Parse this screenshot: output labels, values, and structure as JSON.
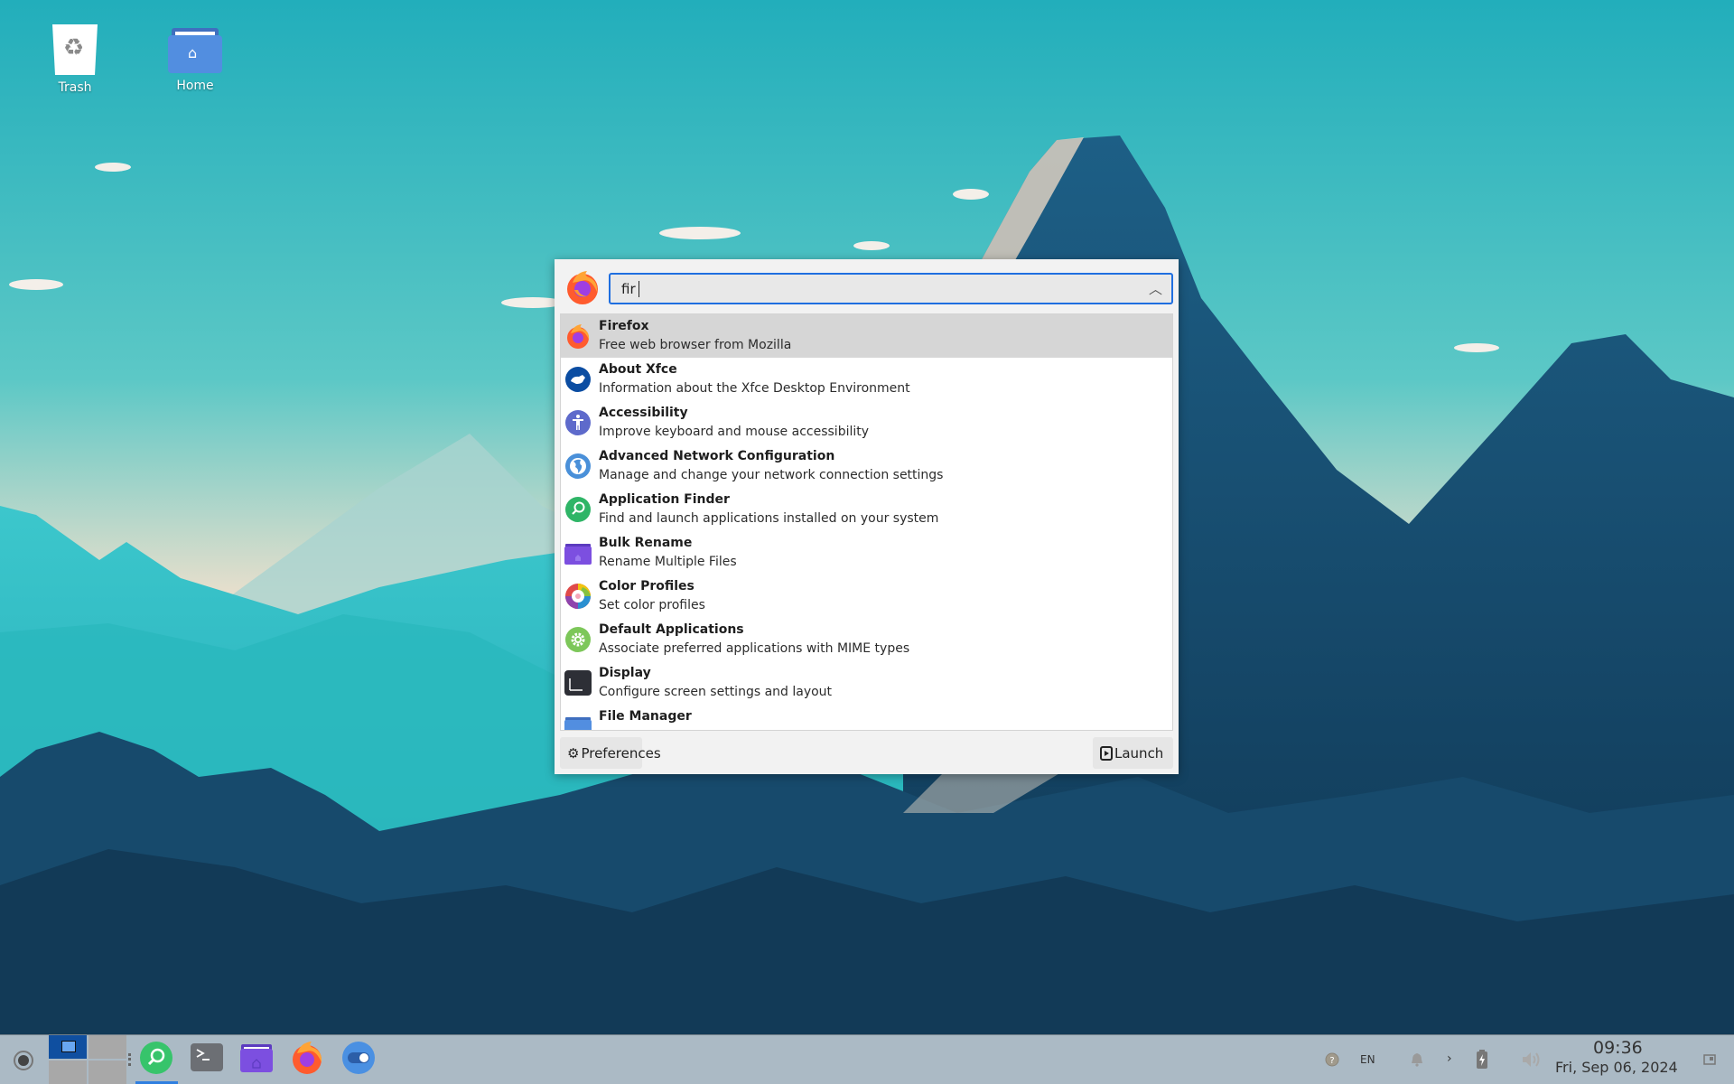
{
  "desktop": {
    "icons": [
      {
        "label": "Trash",
        "icon": "trash-icon"
      },
      {
        "label": "Home",
        "icon": "home-folder-icon"
      }
    ]
  },
  "app_finder": {
    "app_icon": "firefox-icon",
    "search": {
      "value": "fir",
      "placeholder": ""
    },
    "collapse_icon": "chevron-up-icon",
    "results": [
      {
        "name": "Firefox",
        "description": "Free web browser from Mozilla",
        "icon": "firefox-icon",
        "selected": true
      },
      {
        "name": "About Xfce",
        "description": "Information about the Xfce Desktop Environment",
        "icon": "xfce-mouse-icon"
      },
      {
        "name": "Accessibility",
        "description": "Improve keyboard and mouse accessibility",
        "icon": "accessibility-icon"
      },
      {
        "name": "Advanced Network Configuration",
        "description": "Manage and change your network connection settings",
        "icon": "network-globe-icon"
      },
      {
        "name": "Application Finder",
        "description": "Find and launch applications installed on your system",
        "icon": "search-icon"
      },
      {
        "name": "Bulk Rename",
        "description": "Rename Multiple Files",
        "icon": "folder-icon"
      },
      {
        "name": "Color Profiles",
        "description": "Set color profiles",
        "icon": "color-wheel-icon"
      },
      {
        "name": "Default Applications",
        "description": "Associate preferred applications with MIME types",
        "icon": "gear-icon"
      },
      {
        "name": "Display",
        "description": "Configure screen settings and layout",
        "icon": "display-icon"
      },
      {
        "name": "File Manager",
        "description": "",
        "icon": "folder-icon"
      }
    ],
    "buttons": {
      "preferences": {
        "label": "Preferences",
        "icon": "gear-icon"
      },
      "launch": {
        "label": "Launch",
        "icon": "play-icon"
      }
    }
  },
  "panel": {
    "menu_icon": "whisker-menu-icon",
    "workspaces": {
      "count": 4,
      "active": 1
    },
    "launchers": [
      {
        "name": "Application Finder",
        "icon": "search-icon",
        "active": true
      },
      {
        "name": "Terminal",
        "icon": "terminal-icon"
      },
      {
        "name": "File Manager",
        "icon": "folder-icon"
      },
      {
        "name": "Firefox",
        "icon": "firefox-icon"
      },
      {
        "name": "Settings",
        "icon": "toggle-icon"
      }
    ],
    "tray": {
      "help_icon": "help-icon",
      "keyboard_layout": "EN",
      "notifications_icon": "bell-icon",
      "expand_icon": "chevron-right-icon",
      "battery_icon": "battery-charging-icon",
      "volume_icon": "volume-icon",
      "show_desktop_icon": "show-desktop-icon"
    },
    "clock": {
      "time": "09:36",
      "date": "Fri, Sep 06, 2024"
    }
  },
  "colors": {
    "accent": "#1f6fe0",
    "selection": "#d6d6d6",
    "dialog_bg": "#f2f2f2",
    "workspace_active": "#0f4fa0"
  }
}
